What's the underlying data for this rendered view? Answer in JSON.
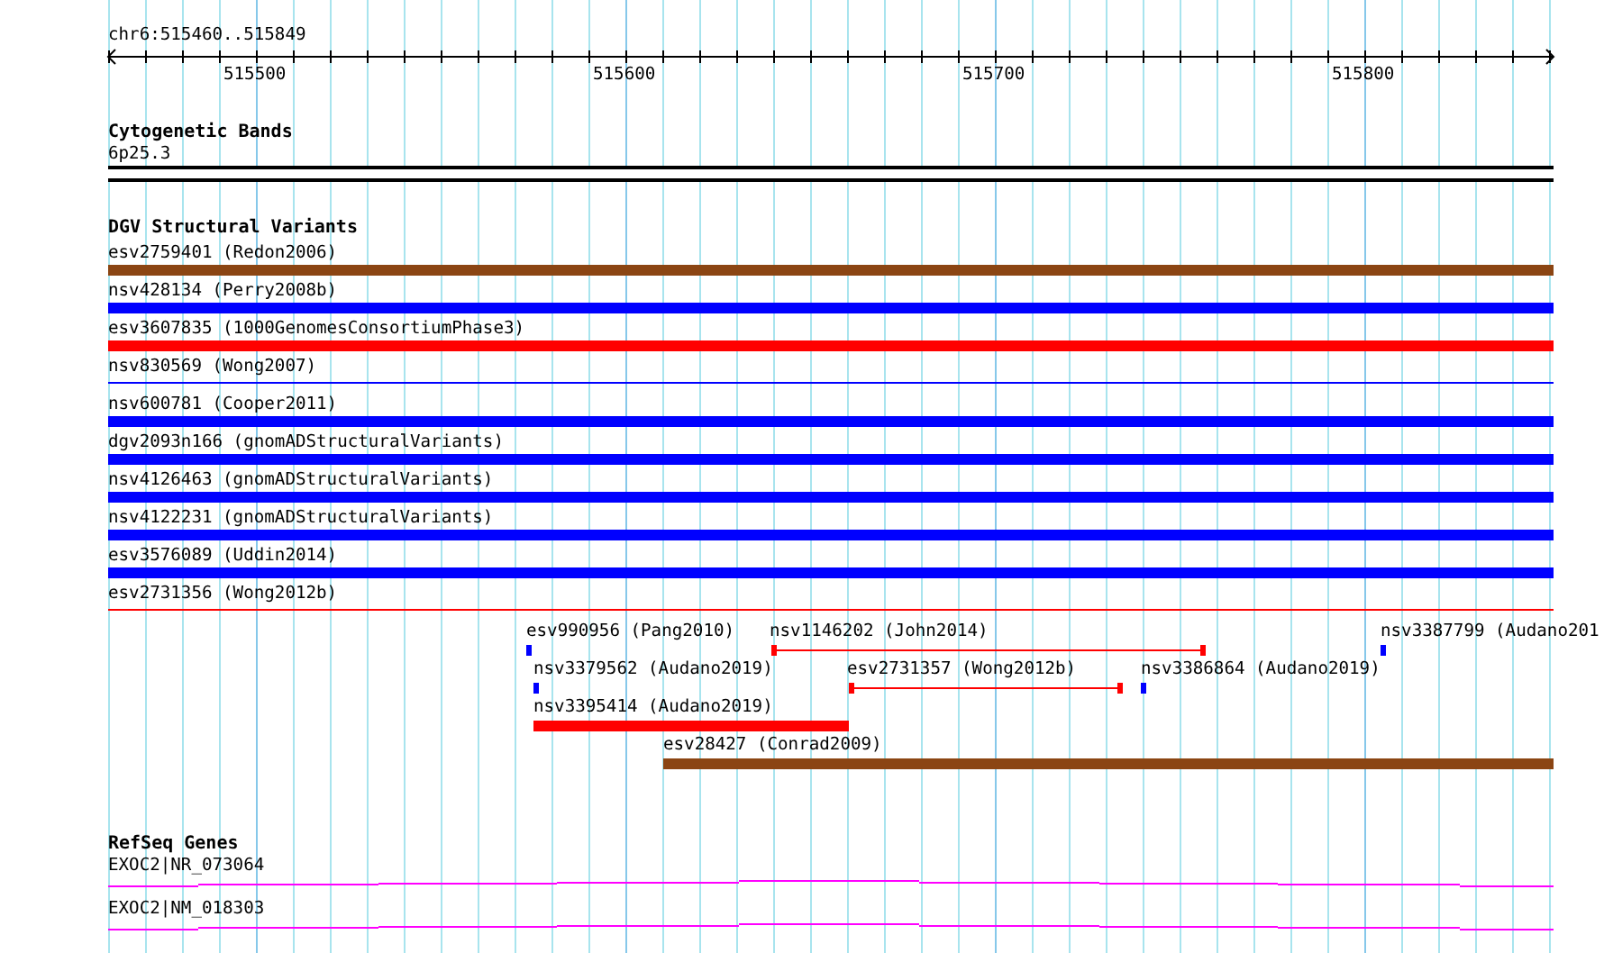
{
  "ruler": {
    "label": "chr6:515460..515849",
    "ticks": [
      "515500",
      "515600",
      "515700",
      "515800"
    ]
  },
  "cytogenetic_bands": {
    "title": "Cytogenetic Bands",
    "features": [
      {
        "label": "6p25.3"
      }
    ]
  },
  "dgv": {
    "title": "DGV Structural Variants",
    "rows": [
      {
        "label": "esv2759401 (Redon2006)",
        "kind": "thick",
        "color": "#8b4513"
      },
      {
        "label": "nsv428134 (Perry2008b)",
        "kind": "thick",
        "color": "#0000ff"
      },
      {
        "label": "esv3607835 (1000GenomesConsortiumPhase3)",
        "kind": "thick",
        "color": "#ff0000"
      },
      {
        "label": "nsv830569 (Wong2007)",
        "kind": "thin",
        "color": "#0000ff"
      },
      {
        "label": "nsv600781 (Cooper2011)",
        "kind": "thick",
        "color": "#0000ff"
      },
      {
        "label": "dgv2093n166 (gnomADStructuralVariants)",
        "kind": "thick",
        "color": "#0000ff"
      },
      {
        "label": "nsv4126463 (gnomADStructuralVariants)",
        "kind": "thick",
        "color": "#0000ff"
      },
      {
        "label": "nsv4122231 (gnomADStructuralVariants)",
        "kind": "thick",
        "color": "#0000ff"
      },
      {
        "label": "esv3576089 (Uddin2014)",
        "kind": "thick",
        "color": "#0000ff"
      },
      {
        "label": "esv2731356 (Wong2012b)",
        "kind": "thin",
        "color": "#ff0000"
      }
    ],
    "packed": [
      {
        "label": "esv990956 (Pang2010)",
        "kind": "point",
        "color": "#0000ff"
      },
      {
        "label": "nsv1146202 (John2014)",
        "kind": "interval",
        "color": "#ff0000"
      },
      {
        "label": "nsv3387799 (Audano201",
        "kind": "point",
        "color": "#0000ff"
      },
      {
        "label": "nsv3379562 (Audano2019)",
        "kind": "point",
        "color": "#0000ff"
      },
      {
        "label": "esv2731357 (Wong2012b)",
        "kind": "interval",
        "color": "#ff0000"
      },
      {
        "label": "nsv3386864 (Audano2019)",
        "kind": "point",
        "color": "#0000ff"
      },
      {
        "label": "nsv3395414 (Audano2019)",
        "kind": "thick",
        "color": "#ff0000"
      },
      {
        "label": "esv28427 (Conrad2009)",
        "kind": "thick",
        "color": "#8b4513"
      }
    ]
  },
  "refseq": {
    "title": "RefSeq Genes",
    "genes": [
      {
        "label": "EXOC2|NR_073064"
      },
      {
        "label": "EXOC2|NM_018303"
      }
    ]
  }
}
